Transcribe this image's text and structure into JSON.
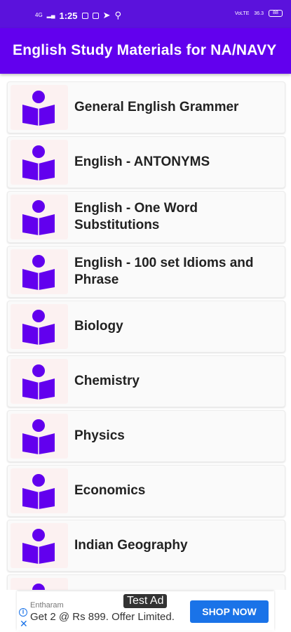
{
  "status_bar": {
    "signal_text": "4G",
    "time": "1:25",
    "net_speed": "36.3",
    "battery": "88"
  },
  "app_bar": {
    "title": "English Study Materials for NA/NAVY"
  },
  "list": {
    "items": [
      {
        "label": "General English Grammer"
      },
      {
        "label": "English - ANTONYMS"
      },
      {
        "label": "English - One Word Substitutions"
      },
      {
        "label": "English - 100 set Idioms and Phrase"
      },
      {
        "label": "Biology"
      },
      {
        "label": "Chemistry"
      },
      {
        "label": "Physics"
      },
      {
        "label": "Economics"
      },
      {
        "label": "Indian Geography"
      },
      {
        "label": ""
      }
    ],
    "icon": "reading-person-icon",
    "icon_color": "#6200ee"
  },
  "ad": {
    "badge": "Test Ad",
    "brand": "Entharam",
    "text": "Get 2 @ Rs 899. Offer Limited.",
    "button": "SHOP NOW",
    "button_color": "#1a73e8"
  },
  "colors": {
    "app_bar": "#6200ee",
    "status_bar": "#5b12dc"
  }
}
